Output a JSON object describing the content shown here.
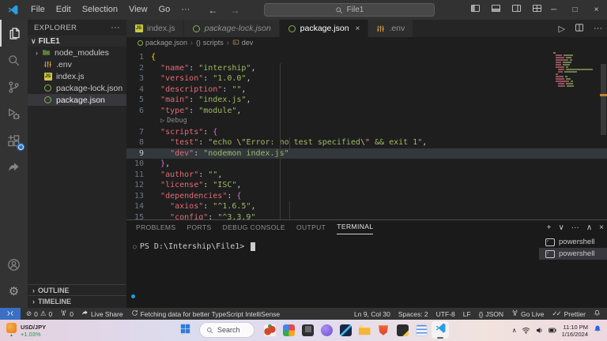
{
  "titlebar": {
    "menus": [
      "File",
      "Edit",
      "Selection",
      "View",
      "Go",
      "···"
    ],
    "nav": [
      "back",
      "forward"
    ],
    "search_value": "File1",
    "layout_controls": [
      "toggle-primary-sidebar",
      "toggle-panel",
      "toggle-secondary-sidebar",
      "customize-layout"
    ],
    "window_controls": [
      "minimize",
      "restore",
      "close"
    ]
  },
  "activity_bar": {
    "items": [
      {
        "name": "explorer",
        "active": true
      },
      {
        "name": "search",
        "active": false
      },
      {
        "name": "source-control",
        "active": false
      },
      {
        "name": "run-and-debug",
        "active": false
      },
      {
        "name": "extensions",
        "active": false,
        "badge": true
      },
      {
        "name": "live-share",
        "active": false
      }
    ],
    "bottom": [
      {
        "name": "accounts"
      },
      {
        "name": "manage"
      }
    ]
  },
  "explorer": {
    "header": "EXPLORER",
    "folder": "FILE1",
    "items": [
      {
        "label": "node_modules",
        "icon": "folder",
        "chevron": true,
        "selected": false
      },
      {
        "label": ".env",
        "icon": "env",
        "chevron": false,
        "selected": false
      },
      {
        "label": "index.js",
        "icon": "js",
        "chevron": false,
        "selected": false
      },
      {
        "label": "package-lock.json",
        "icon": "npm",
        "chevron": false,
        "selected": false
      },
      {
        "label": "package.json",
        "icon": "npm",
        "chevron": false,
        "selected": true
      }
    ],
    "sections": [
      "OUTLINE",
      "TIMELINE"
    ]
  },
  "editor": {
    "tabs": [
      {
        "label": "index.js",
        "icon": "js",
        "active": false,
        "italic": false
      },
      {
        "label": "package-lock.json",
        "icon": "npm",
        "active": false,
        "italic": true
      },
      {
        "label": "package.json",
        "icon": "npm",
        "active": true,
        "italic": false
      },
      {
        "label": ".env",
        "icon": "env",
        "active": false,
        "italic": false
      }
    ],
    "actions": [
      "run",
      "split-editor",
      "more-actions"
    ],
    "breadcrumb": [
      {
        "label": "package.json",
        "icon": "npm"
      },
      {
        "label": "scripts",
        "icon": "braces"
      },
      {
        "label": "dev",
        "icon": "symbol-property"
      }
    ],
    "codelens_label": "Debug",
    "codelens_before_line": 7,
    "current_line": 9,
    "lines": [
      {
        "n": 1,
        "segs": [
          [
            "{",
            "b1"
          ]
        ]
      },
      {
        "n": 2,
        "segs": [
          [
            "  ",
            "t"
          ],
          [
            "\"name\"",
            "k"
          ],
          [
            ": ",
            "p"
          ],
          [
            "\"intership\"",
            "s"
          ],
          [
            ",",
            "p"
          ]
        ]
      },
      {
        "n": 3,
        "segs": [
          [
            "  ",
            "t"
          ],
          [
            "\"version\"",
            "k"
          ],
          [
            ": ",
            "p"
          ],
          [
            "\"1.0.0\"",
            "s"
          ],
          [
            ",",
            "p"
          ]
        ]
      },
      {
        "n": 4,
        "segs": [
          [
            "  ",
            "t"
          ],
          [
            "\"description\"",
            "k"
          ],
          [
            ": ",
            "p"
          ],
          [
            "\"\"",
            "s"
          ],
          [
            ",",
            "p"
          ]
        ]
      },
      {
        "n": 5,
        "segs": [
          [
            "  ",
            "t"
          ],
          [
            "\"main\"",
            "k"
          ],
          [
            ": ",
            "p"
          ],
          [
            "\"index.js\"",
            "s"
          ],
          [
            ",",
            "p"
          ]
        ]
      },
      {
        "n": 6,
        "segs": [
          [
            "  ",
            "t"
          ],
          [
            "\"type\"",
            "k"
          ],
          [
            ": ",
            "p"
          ],
          [
            "\"module\"",
            "s"
          ],
          [
            ",",
            "p"
          ]
        ]
      },
      {
        "n": 7,
        "segs": [
          [
            "  ",
            "t"
          ],
          [
            "\"scripts\"",
            "k"
          ],
          [
            ": ",
            "p"
          ],
          [
            "{",
            "b2"
          ]
        ]
      },
      {
        "n": 8,
        "segs": [
          [
            "    ",
            "t"
          ],
          [
            "\"test\"",
            "k"
          ],
          [
            ": ",
            "p"
          ],
          [
            "\"echo ",
            "s"
          ],
          [
            "\\\"",
            "e"
          ],
          [
            "Error: no test specified",
            "s"
          ],
          [
            "\\\"",
            "e"
          ],
          [
            " && exit 1\"",
            "s"
          ],
          [
            ",",
            "p"
          ]
        ]
      },
      {
        "n": 9,
        "segs": [
          [
            "    ",
            "t"
          ],
          [
            "\"dev\"",
            "k"
          ],
          [
            ": ",
            "p"
          ],
          [
            "\"nodemon index.js\"",
            "s"
          ]
        ]
      },
      {
        "n": 10,
        "segs": [
          [
            "  ",
            "t"
          ],
          [
            "}",
            "b2"
          ],
          [
            ",",
            "p"
          ]
        ]
      },
      {
        "n": 11,
        "segs": [
          [
            "  ",
            "t"
          ],
          [
            "\"author\"",
            "k"
          ],
          [
            ": ",
            "p"
          ],
          [
            "\"\"",
            "s"
          ],
          [
            ",",
            "p"
          ]
        ]
      },
      {
        "n": 12,
        "segs": [
          [
            "  ",
            "t"
          ],
          [
            "\"license\"",
            "k"
          ],
          [
            ": ",
            "p"
          ],
          [
            "\"ISC\"",
            "s"
          ],
          [
            ",",
            "p"
          ]
        ]
      },
      {
        "n": 13,
        "segs": [
          [
            "  ",
            "t"
          ],
          [
            "\"dependencies\"",
            "k"
          ],
          [
            ": ",
            "p"
          ],
          [
            "{",
            "b2"
          ]
        ]
      },
      {
        "n": 14,
        "segs": [
          [
            "    ",
            "t"
          ],
          [
            "\"axios\"",
            "k"
          ],
          [
            ": ",
            "p"
          ],
          [
            "\"^1.6.5\"",
            "s"
          ],
          [
            ",",
            "p"
          ]
        ]
      },
      {
        "n": 15,
        "segs": [
          [
            "    ",
            "t"
          ],
          [
            "\"config\"",
            "k"
          ],
          [
            ": ",
            "p"
          ],
          [
            "\"^3.3.9\"",
            "s"
          ]
        ]
      }
    ],
    "minimap_rows": [
      [
        0,
        3,
        0,
        "g"
      ],
      [
        3,
        8,
        12
      ],
      [
        3,
        11,
        7
      ],
      [
        3,
        16,
        3
      ],
      [
        3,
        7,
        11
      ],
      [
        3,
        7,
        9
      ],
      [
        3,
        11,
        3
      ],
      [
        6,
        8,
        34
      ],
      [
        6,
        6,
        16
      ],
      [
        3,
        3,
        0
      ],
      [
        3,
        10,
        3
      ],
      [
        3,
        11,
        6
      ],
      [
        3,
        17,
        3
      ],
      [
        6,
        8,
        9
      ],
      [
        6,
        9,
        9
      ]
    ]
  },
  "panel": {
    "tabs": [
      "PROBLEMS",
      "PORTS",
      "DEBUG CONSOLE",
      "OUTPUT",
      "TERMINAL"
    ],
    "active_tab": "TERMINAL",
    "actions": [
      "new-terminal",
      "dropdown",
      "more",
      "maximize",
      "close"
    ],
    "prompt": "PS D:\\Intership\\File1>",
    "terminal_list": [
      {
        "label": "powershell",
        "selected": false
      },
      {
        "label": "powershell",
        "selected": true
      }
    ]
  },
  "status_bar": {
    "left": [
      {
        "name": "remote",
        "parts": [
          {
            "icon": "remote"
          }
        ]
      },
      {
        "name": "problems",
        "parts": [
          {
            "icon": "error"
          },
          {
            "text": "0"
          },
          {
            "icon": "warning"
          },
          {
            "text": "0"
          }
        ]
      },
      {
        "name": "forwarded-ports",
        "parts": [
          {
            "icon": "broadcast-tower"
          },
          {
            "text": "0"
          }
        ]
      },
      {
        "name": "live-share",
        "parts": [
          {
            "icon": "live-share"
          },
          {
            "text": "Live Share"
          }
        ]
      },
      {
        "name": "typescript-intellisense",
        "parts": [
          {
            "icon": "sync"
          },
          {
            "text": "Fetching data for better TypeScript IntelliSense"
          }
        ]
      }
    ],
    "right": [
      {
        "name": "cursor-position",
        "parts": [
          {
            "text": "Ln 9, Col 30"
          }
        ]
      },
      {
        "name": "indentation",
        "parts": [
          {
            "text": "Spaces: 2"
          }
        ]
      },
      {
        "name": "encoding",
        "parts": [
          {
            "text": "UTF-8"
          }
        ]
      },
      {
        "name": "eol",
        "parts": [
          {
            "text": "LF"
          }
        ]
      },
      {
        "name": "language-mode",
        "parts": [
          {
            "icon": "braces"
          },
          {
            "text": "JSON"
          }
        ]
      },
      {
        "name": "go-live",
        "parts": [
          {
            "icon": "broadcast-tower"
          },
          {
            "text": "Go Live"
          }
        ]
      },
      {
        "name": "prettier",
        "parts": [
          {
            "icon": "double-check"
          },
          {
            "text": "Prettier"
          }
        ]
      },
      {
        "name": "notifications",
        "parts": [
          {
            "icon": "bell"
          }
        ]
      }
    ]
  },
  "taskbar": {
    "widget": {
      "symbol": "USD/JPY",
      "change": "+1.03%"
    },
    "search_label": "Search",
    "apps": [
      "peppers-app",
      "photos-app",
      "stack-app",
      "chat-app",
      "dev-app",
      "file-explorer",
      "brave-browser",
      "code-editor-dark",
      "notes-app",
      "vscode"
    ],
    "active_app": "vscode",
    "tray": [
      "tray-expand",
      "wifi",
      "volume",
      "battery"
    ],
    "clock_time": "11:10 PM",
    "clock_date": "1/16/2024"
  },
  "colors": {
    "status_remote_bg": "#3a6fc4",
    "selection": "#37373d",
    "json_key": "#e06c75",
    "json_string": "#9dbb62",
    "bracket_gold": "#ffd700",
    "bracket_purple": "#d670d6",
    "taskbar_gain_green": "#0f9d46"
  }
}
